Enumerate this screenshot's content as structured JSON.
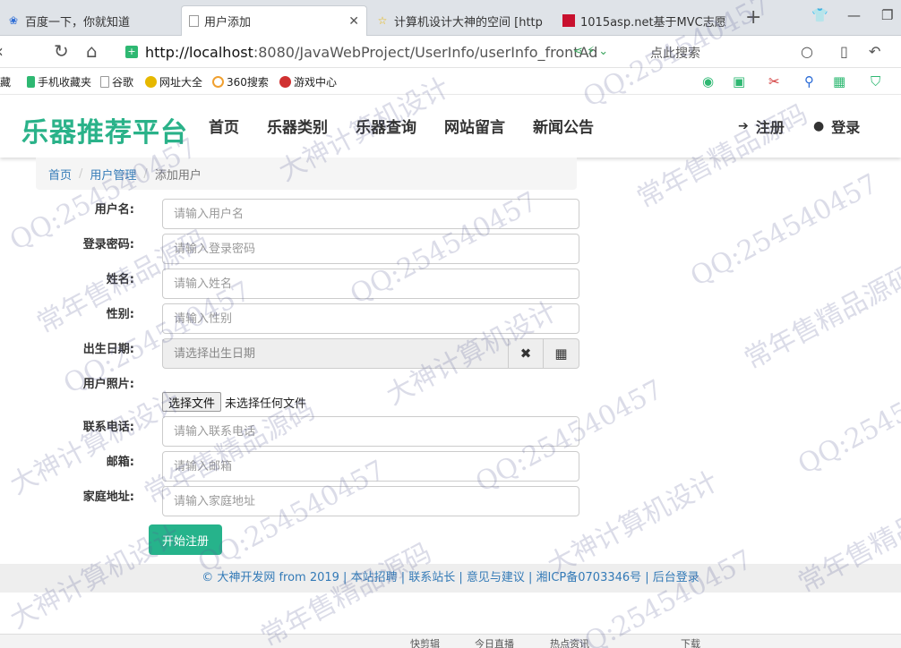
{
  "browser": {
    "tabs": [
      {
        "title": "百度一下，你就知道",
        "icon": "baidu-paw-icon",
        "active": false
      },
      {
        "title": "用户添加",
        "icon": "page-icon",
        "active": true
      },
      {
        "title": "计算机设计大神的空间 [http",
        "icon": "star-icon",
        "active": false
      },
      {
        "title": "1015asp.net基于MVC志愿",
        "icon": "red-square-icon",
        "active": false
      }
    ],
    "url_host": "http://localhost",
    "url_rest": ":8080/JavaWebProject/UserInfo/userInfo_frontAd",
    "search_placeholder": "点此搜索",
    "bookmarks": [
      {
        "label": "藏",
        "color": "#4a90d9"
      },
      {
        "label": "手机收藏夹",
        "color": "#2eb872"
      },
      {
        "label": "谷歌",
        "color": "#bbbbbb"
      },
      {
        "label": "网址大全",
        "color": "#e6b800"
      },
      {
        "label": "360搜索",
        "color": "#f0a030"
      },
      {
        "label": "游戏中心",
        "color": "#d03030"
      }
    ]
  },
  "site": {
    "brand": "乐器推荐平台",
    "nav": [
      "首页",
      "乐器类别",
      "乐器查询",
      "网站留言",
      "新闻公告"
    ],
    "register": "注册",
    "login": "登录"
  },
  "breadcrumb": {
    "home": "首页",
    "section": "用户管理",
    "current": "添加用户"
  },
  "form": {
    "username_label": "用户名:",
    "username_placeholder": "请输入用户名",
    "password_label": "登录密码:",
    "password_placeholder": "请输入登录密码",
    "name_label": "姓名:",
    "name_placeholder": "请输入姓名",
    "gender_label": "性别:",
    "gender_placeholder": "请输入性别",
    "birth_label": "出生日期:",
    "birth_placeholder": "请选择出生日期",
    "photo_label": "用户照片:",
    "file_button": "选择文件",
    "file_status": "未选择任何文件",
    "phone_label": "联系电话:",
    "phone_placeholder": "请输入联系电话",
    "email_label": "邮箱:",
    "email_placeholder": "请输入邮箱",
    "address_label": "家庭地址:",
    "address_placeholder": "请输入家庭地址",
    "submit": "开始注册"
  },
  "footer": {
    "text": "© 大神开发网 from 2019 | 本站招聘 | 联系站长 | 意见与建议 | 湘ICP备0703346号 | 后台登录"
  },
  "statusbar": {
    "items": [
      "快剪辑",
      "今日直播",
      "热点资讯",
      "下载"
    ]
  },
  "watermark": {
    "texts": [
      "QQ:254540457",
      "常年售精品源码",
      "大神计算机设计"
    ]
  },
  "colors": {
    "brand": "#2ab289",
    "submit": "#26b38b",
    "link": "#337ab7"
  }
}
